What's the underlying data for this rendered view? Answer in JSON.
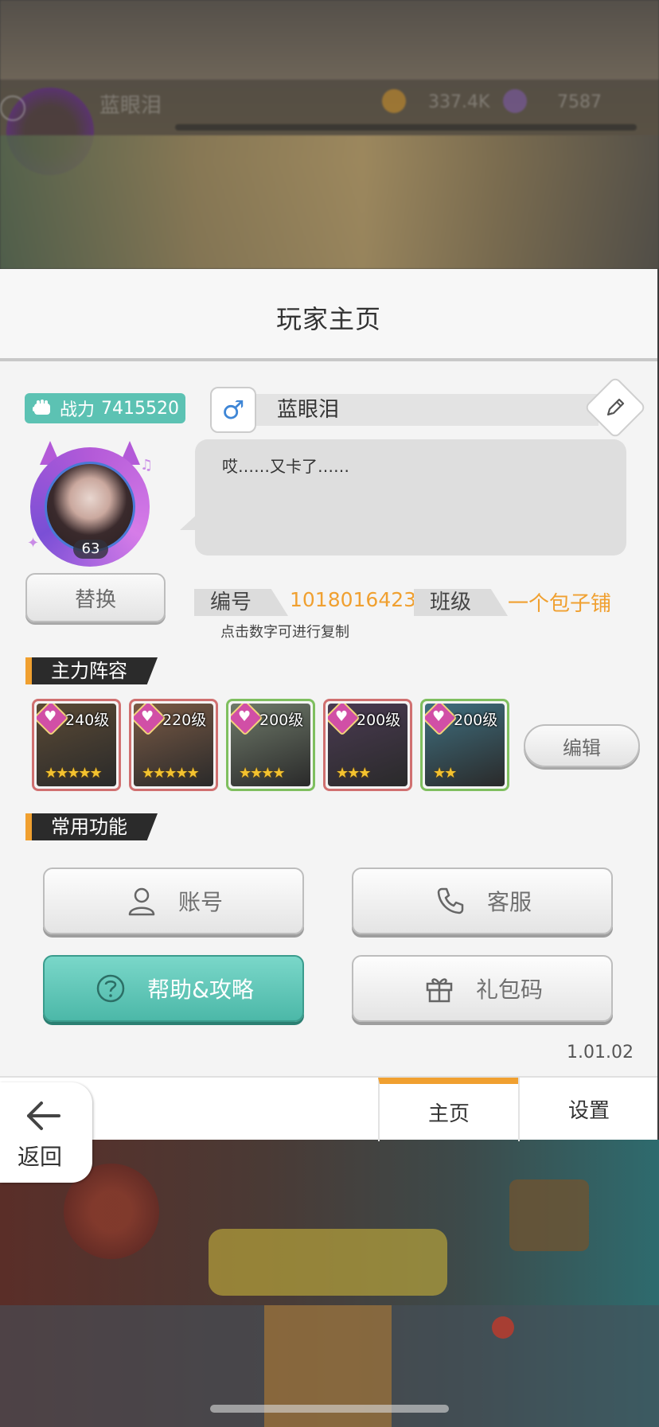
{
  "background_hud": {
    "player_name": "蓝眼泪",
    "coins": "337.4K",
    "gems": "7587"
  },
  "panel": {
    "title": "玩家主页"
  },
  "profile": {
    "power_label": "战力",
    "power_value": "7415520",
    "level": "63",
    "gender_symbol": "♂",
    "name": "蓝眼泪",
    "signature": "哎……又卡了……",
    "replace_label": "替换",
    "id_label": "编号",
    "id_value": "1018016423",
    "class_label": "班级",
    "class_value": "一个包子铺",
    "copy_hint": "点击数字可进行复制"
  },
  "lineup": {
    "section_title": "主力阵容",
    "edit_label": "编辑",
    "heroes": [
      {
        "level": "240级",
        "stars": 5,
        "star_text": "★★★★★",
        "frame": "#d07070",
        "art": "#5b4a35"
      },
      {
        "level": "220级",
        "stars": 5,
        "star_text": "★★★★★",
        "frame": "#d07070",
        "art": "#7a5a45"
      },
      {
        "level": "200级",
        "stars": 4,
        "star_text": "★★★★",
        "frame": "#7fbf5f",
        "art": "#6f7a6a"
      },
      {
        "level": "200级",
        "stars": 3,
        "star_text": "★★★",
        "frame": "#d07070",
        "art": "#4a3a52"
      },
      {
        "level": "200级",
        "stars": 2,
        "star_text": "★★",
        "frame": "#7fbf5f",
        "art": "#3f6f7f"
      }
    ]
  },
  "functions": {
    "section_title": "常用功能",
    "account": "账号",
    "service": "客服",
    "help": "帮助&攻略",
    "gift": "礼包码"
  },
  "version": "1.01.02",
  "tabs": {
    "home": "主页",
    "settings": "设置"
  },
  "back": {
    "label": "返回"
  },
  "colors": {
    "accent": "#f0a030",
    "teal": "#5cc2b3"
  }
}
